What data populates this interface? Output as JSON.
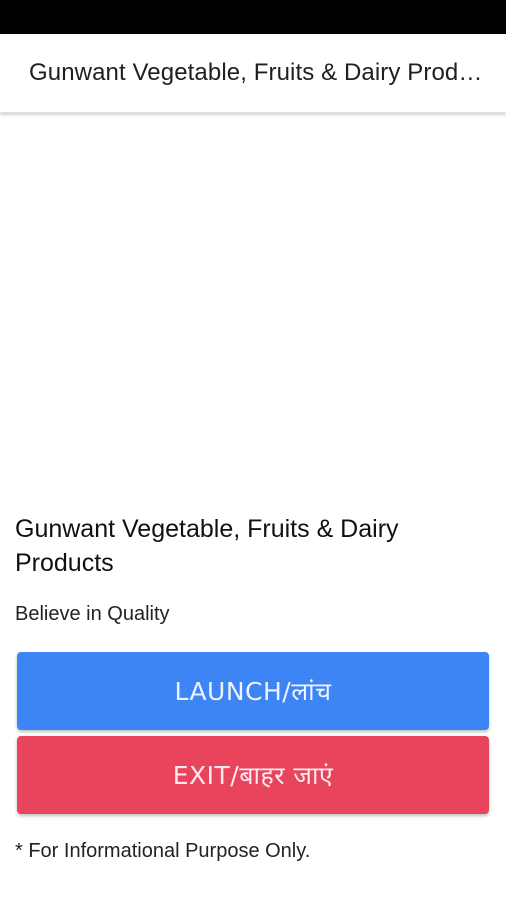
{
  "app_bar": {
    "title": "Gunwant Vegetable, Fruits & Dairy Products"
  },
  "main": {
    "business_name": "Gunwant Vegetable, Fruits & Dairy Products",
    "tagline": "Believe in Quality",
    "launch_button_label": "LAUNCH/लांच",
    "exit_button_label": "EXIT/बाहर जाएं",
    "disclaimer": "* For Informational Purpose Only."
  },
  "colors": {
    "launch_button": "#3d84f5",
    "exit_button": "#e8445c",
    "status_bar": "#000000"
  }
}
